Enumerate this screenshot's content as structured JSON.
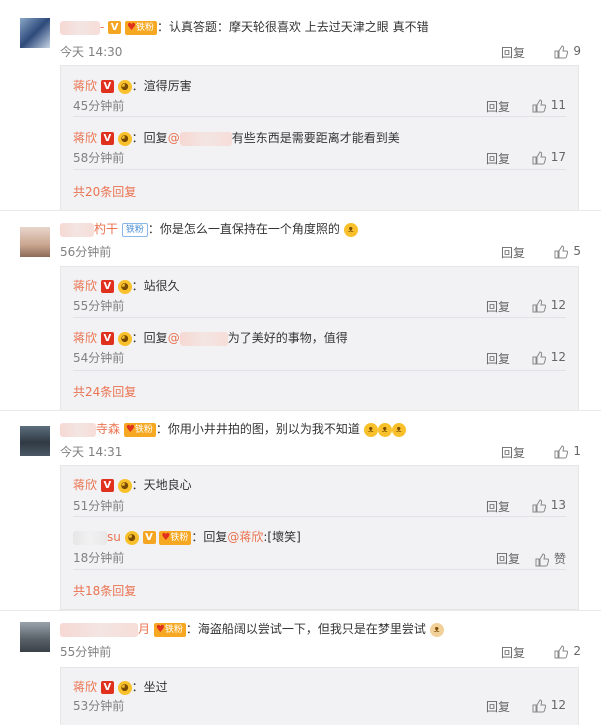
{
  "labels": {
    "reply": "回复",
    "like_placeholder": "赞"
  },
  "comments": [
    {
      "text": "：认真答题：摩天轮很喜欢 上去过天津之眼 真不错",
      "badge": "铁粉",
      "time": "今天 14:30",
      "likes": "9",
      "replies": [
        {
          "user": "蒋欣",
          "text": "：渲得厉害",
          "time": "45分钟前",
          "likes": "11"
        },
        {
          "user": "蒋欣",
          "text_pre": "：回复",
          "mention": "@",
          "text_post": "有些东西是需要距离才能看到美",
          "time": "58分钟前",
          "likes": "17"
        }
      ],
      "more": "共20条回复"
    },
    {
      "name_partial": "杓干",
      "badge": "铁粉",
      "text": "：你是怎么一直保持在一个角度照的",
      "time": "56分钟前",
      "likes": "5",
      "replies": [
        {
          "user": "蒋欣",
          "text": "：站很久",
          "time": "55分钟前",
          "likes": "12"
        },
        {
          "user": "蒋欣",
          "text_pre": "：回复",
          "mention": "@",
          "text_post": "为了美好的事物，值得",
          "time": "54分钟前",
          "likes": "12"
        }
      ],
      "more": "共24条回复"
    },
    {
      "name_partial": "寺森",
      "badge": "铁粉",
      "text": "：你用小井井拍的图，别以为我不知道",
      "time": "今天 14:31",
      "likes": "1",
      "replies": [
        {
          "user": "蒋欣",
          "text": "：天地良心",
          "time": "51分钟前",
          "likes": "13"
        },
        {
          "name_partial": "su",
          "badge": "铁粉",
          "text_pre": "：回复",
          "mention": "@蒋欣",
          "text_post": ":[壞笑]",
          "time": "18分钟前",
          "likes": "赞"
        }
      ],
      "more": "共18条回复"
    },
    {
      "name_partial": "月",
      "badge": "铁粉",
      "text": "：海盗船阔以尝试一下，但我只是在梦里尝试",
      "time": "55分钟前",
      "likes": "2",
      "replies": [
        {
          "user": "蒋欣",
          "text": "：坐过",
          "time": "53分钟前",
          "likes": "12"
        }
      ]
    }
  ]
}
